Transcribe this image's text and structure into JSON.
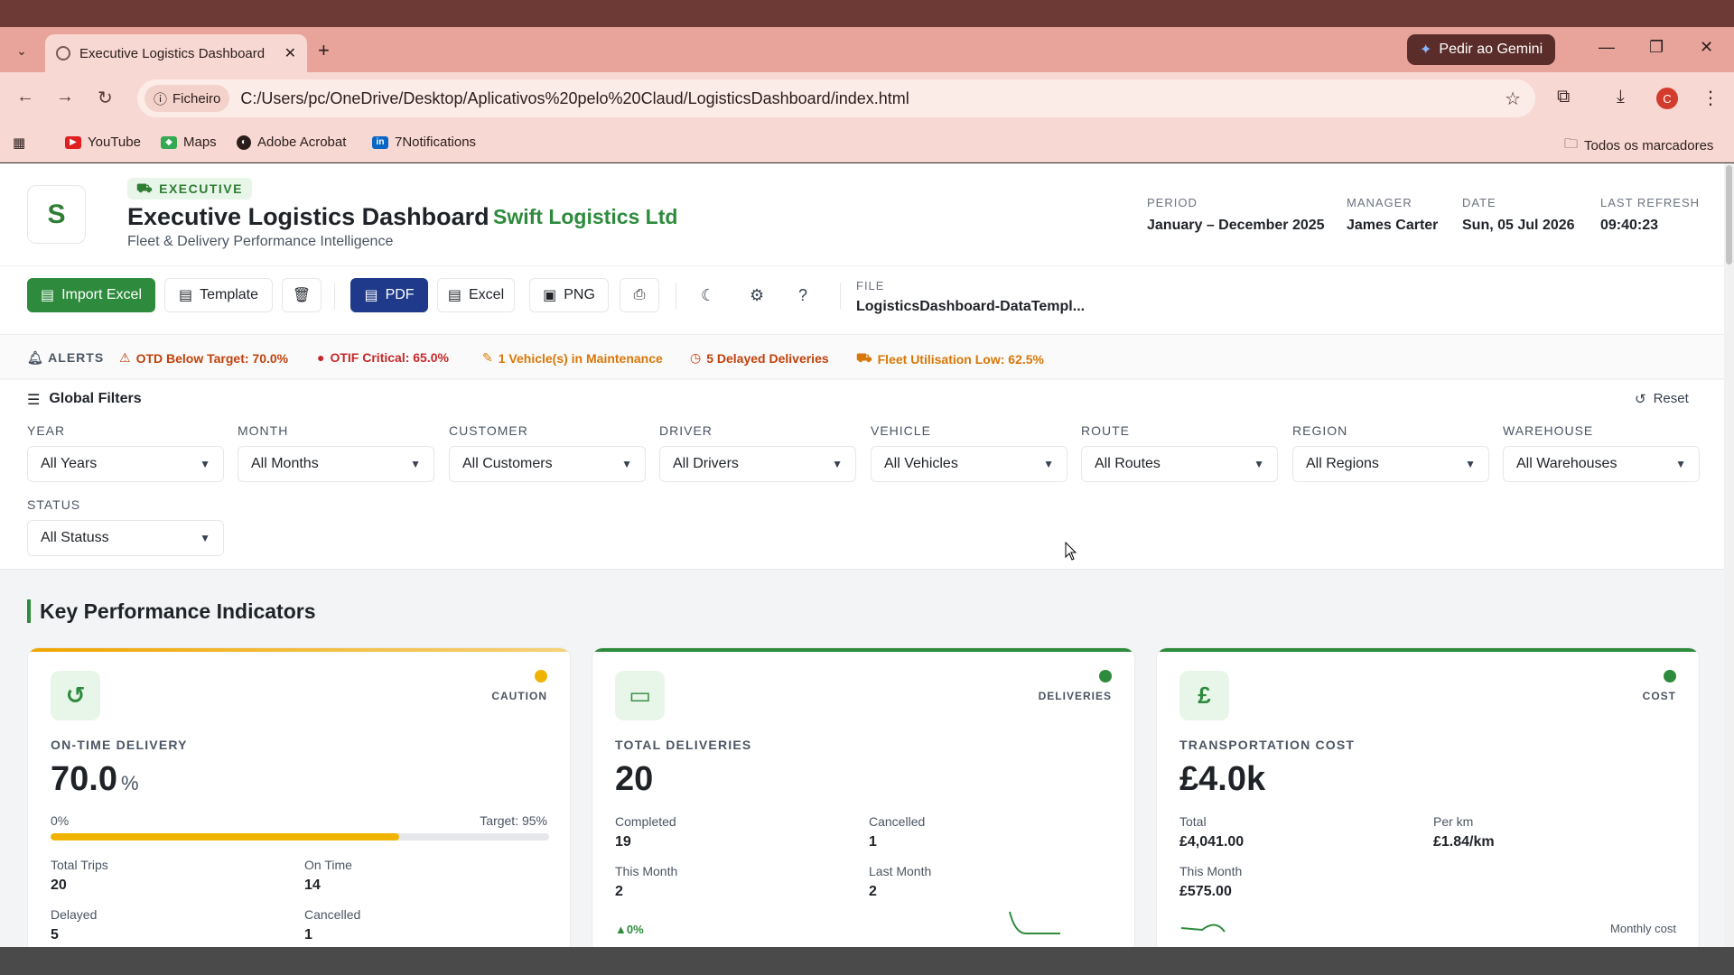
{
  "browser": {
    "tab_title": "Executive Logistics Dashboard",
    "gemini_label": "Pedir ao Gemini",
    "site_chip": "Ficheiro",
    "url": "C:/Users/pc/OneDrive/Desktop/Aplicativos%20pelo%20Claud/LogisticsDashboard/index.html",
    "profile_initial": "C",
    "bookmarks": [
      {
        "label": "YouTube",
        "icon": "youtube-icon"
      },
      {
        "label": "Maps",
        "icon": "maps-icon"
      },
      {
        "label": "Adobe Acrobat",
        "icon": "acrobat-icon"
      },
      {
        "label": "7Notifications",
        "icon": "linkedin-icon"
      }
    ],
    "all_bookmarks": "Todos os marcadores"
  },
  "header": {
    "logo_letter": "S",
    "badge": "EXECUTIVE",
    "title": "Executive Logistics Dashboard",
    "company": "Swift Logistics Ltd",
    "subtitle": "Fleet & Delivery Performance Intelligence",
    "meta": [
      {
        "label": "PERIOD",
        "value": "January – December 2025"
      },
      {
        "label": "MANAGER",
        "value": "James Carter"
      },
      {
        "label": "DATE",
        "value": "Sun, 05 Jul 2026"
      },
      {
        "label": "LAST REFRESH",
        "value": "09:40:23"
      }
    ]
  },
  "actions": {
    "import_excel": "Import Excel",
    "template": "Template",
    "pdf": "PDF",
    "excel": "Excel",
    "png": "PNG",
    "file_label": "FILE",
    "file_value": "LogisticsDashboard-DataTempl..."
  },
  "alerts": {
    "label": "ALERTS",
    "items": [
      {
        "text": "OTD Below Target: 70.0%",
        "color": "#c2410c",
        "icon": "warning-icon"
      },
      {
        "text": "OTIF Critical: 65.0%",
        "color": "#c62828",
        "icon": "error-icon"
      },
      {
        "text": "1 Vehicle(s) in Maintenance",
        "color": "#d97706",
        "icon": "wrench-icon"
      },
      {
        "text": "5 Delayed Deliveries",
        "color": "#c2410c",
        "icon": "clock-icon"
      },
      {
        "text": "Fleet Utilisation Low: 62.5%",
        "color": "#d97706",
        "icon": "truck-icon"
      }
    ]
  },
  "filters": {
    "title": "Global Filters",
    "reset": "Reset",
    "items": [
      {
        "label": "YEAR",
        "value": "All Years"
      },
      {
        "label": "MONTH",
        "value": "All Months"
      },
      {
        "label": "CUSTOMER",
        "value": "All Customers"
      },
      {
        "label": "DRIVER",
        "value": "All Drivers"
      },
      {
        "label": "VEHICLE",
        "value": "All Vehicles"
      },
      {
        "label": "ROUTE",
        "value": "All Routes"
      },
      {
        "label": "REGION",
        "value": "All Regions"
      },
      {
        "label": "WAREHOUSE",
        "value": "All Warehouses"
      },
      {
        "label": "STATUS",
        "value": "All Statuss"
      }
    ]
  },
  "kpi": {
    "heading": "Key Performance Indicators",
    "cards": [
      {
        "tag": "CAUTION",
        "label": "ON-TIME DELIVERY",
        "value": "70.0",
        "unit": "%",
        "progress_min": "0%",
        "progress_target": "Target: 95%",
        "progress_fraction": 0.7,
        "accent": "#f0a500",
        "stats": [
          {
            "label": "Total Trips",
            "value": "20"
          },
          {
            "label": "On Time",
            "value": "14"
          },
          {
            "label": "Delayed",
            "value": "5"
          },
          {
            "label": "Cancelled",
            "value": "1"
          }
        ]
      },
      {
        "tag": "DELIVERIES",
        "label": "TOTAL DELIVERIES",
        "value": "20",
        "accent": "#2e8b3d",
        "stats": [
          {
            "label": "Completed",
            "value": "19"
          },
          {
            "label": "Cancelled",
            "value": "1"
          },
          {
            "label": "This Month",
            "value": "2"
          },
          {
            "label": "Last Month",
            "value": "2"
          }
        ],
        "trend": "▲0%"
      },
      {
        "tag": "COST",
        "label": "TRANSPORTATION COST",
        "value": "£4.0k",
        "accent": "#2e8b3d",
        "stats": [
          {
            "label": "Total",
            "value": "£4,041.00"
          },
          {
            "label": "Per km",
            "value": "£1.84/km"
          },
          {
            "label": "This Month",
            "value": "£575.00"
          }
        ],
        "footer": "Monthly cost"
      }
    ]
  }
}
